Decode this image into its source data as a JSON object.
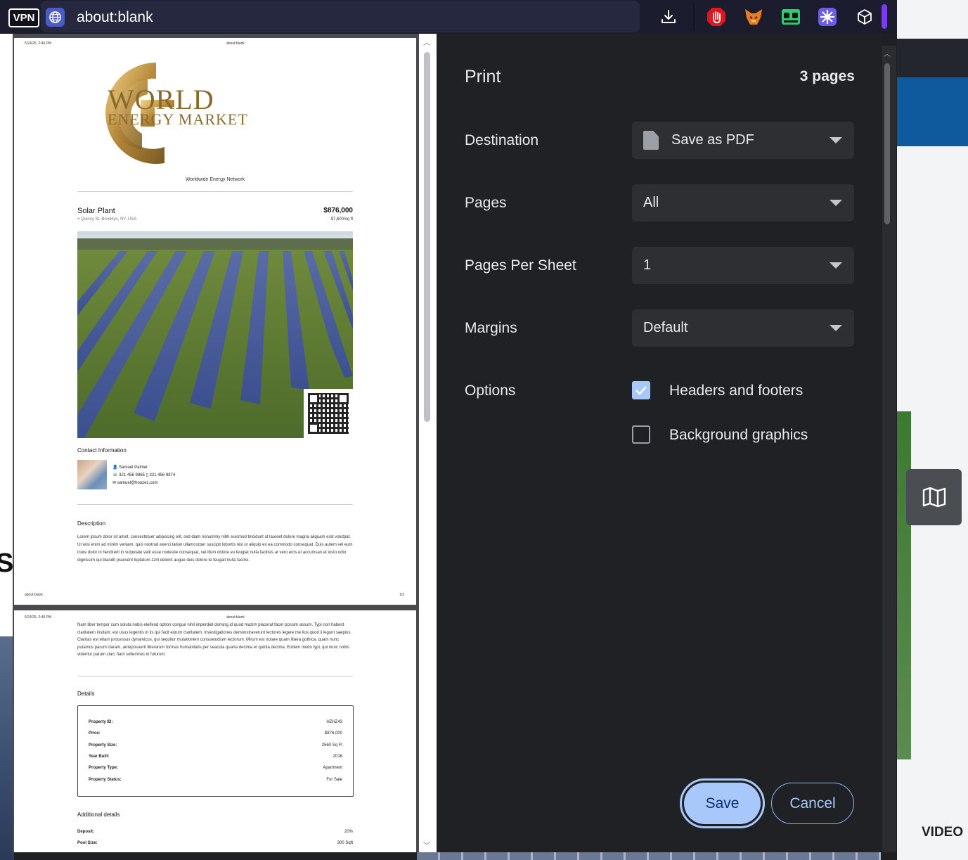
{
  "browser": {
    "vpn_label": "VPN",
    "url": "about:blank",
    "icons": [
      "download-icon",
      "hand-stop-icon",
      "fox-icon",
      "eyes-icon",
      "gear-badge-icon",
      "cube-icon"
    ]
  },
  "background": {
    "video_label": "VIDEO",
    "partial_heading": "So"
  },
  "preview": {
    "header_date": "5/24/25, 2:40 PM",
    "header_title": "about:blank",
    "footer_url": "about:blank",
    "page_number": "1/3",
    "logo_line1": "WORLD",
    "logo_line2": "ENERGY MARKET",
    "tagline": "Worldwide Energy Network",
    "listing_title": "Solar Plant",
    "listing_address": "Quincy St, Brooklyn, NY, USA",
    "listing_price": "$876,000",
    "listing_price_sqft": "$7,600/sq ft",
    "contact_heading": "Contact Information",
    "contact_name": "Samuel Palmer",
    "contact_phone": "321 456 9865",
    "contact_mobile": "321 456 9874",
    "contact_email": "samuel@houzez.com",
    "description_heading": "Description",
    "description_text": "Lorem ipsum dolor sit amet, consectetuer adipiscing elit, sed diam nonummy nibh euismod tincidunt ut laoreet dolore magna aliquam erat volutpat. Ut wisi enim ad minim veniam, quis nostrud exerci tation ullamcorper suscipit lobortis nisl ut aliquip ex ea commodo consequat. Duis autem vel eum iriure dolor in hendrerit in vulputate velit esse molestie consequat, vel illum dolore eu feugiat nulla facilisis at vero eros et accumsan et iusto odio dignissim qui blandit praesent luptatum zzril delenit augue duis dolore te feugait nulla facilisi.",
    "page2_text": "Nam liber tempor cum soluta nobis eleifend option congue nihil imperdiet doming id quod mazim placerat facer possim assum. Typi non habent claritatem insitam; est usus legentis in iis qui facit eorum claritatem. Investigationes demonstraverunt lectores legere me lius quod ii legunt saepius. Claritas est etiam processus dynamicus, qui sequitur mutationem consuetudium lectorum. Mirum est notare quam littera gothica, quam nunc putamus parum claram, anteposuerit litterarum formas humanitatis per seacula quarta decima et quinta decima. Eodem modo typi, qui nunc nobis videntur parum clari, fiant sollemnes in futurum.",
    "details_heading": "Details",
    "details": [
      {
        "label": "Property ID:",
        "value": "HZHZ43"
      },
      {
        "label": "Price:",
        "value": "$876,000"
      },
      {
        "label": "Property Size:",
        "value": "2560 Sq Ft"
      },
      {
        "label": "Year Built:",
        "value": "2016"
      },
      {
        "label": "Property Type:",
        "value": "Apartment"
      },
      {
        "label": "Property Status:",
        "value": "For Sale"
      }
    ],
    "additional_heading": "Additional details",
    "additional": [
      {
        "label": "Deposit:",
        "value": "20%"
      },
      {
        "label": "Pool Size:",
        "value": "300 Sqft"
      }
    ]
  },
  "print": {
    "title": "Print",
    "page_count": "3 pages",
    "destination_label": "Destination",
    "destination_value": "Save as PDF",
    "pages_label": "Pages",
    "pages_value": "All",
    "pps_label": "Pages Per Sheet",
    "pps_value": "1",
    "margins_label": "Margins",
    "margins_value": "Default",
    "options_label": "Options",
    "opt_headers_label": "Headers and footers",
    "opt_headers_checked": true,
    "opt_bg_label": "Background graphics",
    "opt_bg_checked": false,
    "save_label": "Save",
    "cancel_label": "Cancel"
  },
  "colors": {
    "panel_bg": "#202124",
    "accent": "#a8c7fa",
    "select_bg": "#2e2f33",
    "logo_gold": "#8a6a2c"
  }
}
